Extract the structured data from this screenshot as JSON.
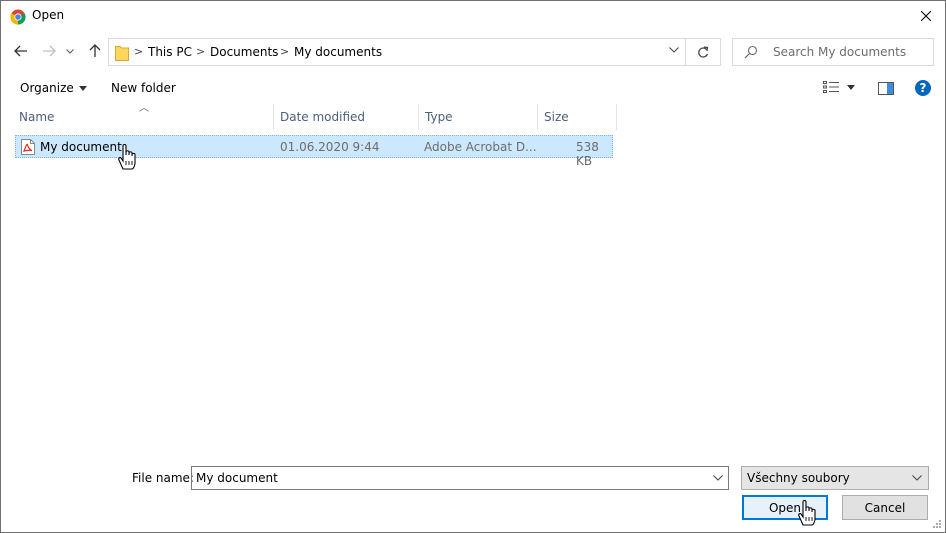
{
  "window": {
    "title": "Open",
    "icons": {
      "app": "chrome-icon",
      "close": "close-icon"
    }
  },
  "nav": {
    "back_icon": "arrow-left-icon",
    "forward_icon": "arrow-right-icon",
    "recent_icon": "chevron-down-icon",
    "up_icon": "arrow-up-icon",
    "breadcrumbs": [
      "This PC",
      "Documents",
      "My documents"
    ],
    "refresh_icon": "refresh-icon",
    "search_placeholder": "Search My documents"
  },
  "toolbar": {
    "organize_label": "Organize",
    "new_folder_label": "New folder",
    "view_icon": "details-view-icon",
    "preview_icon": "preview-pane-icon",
    "help_label": "?"
  },
  "columns": [
    {
      "label": "Name"
    },
    {
      "label": "Date modified"
    },
    {
      "label": "Type"
    },
    {
      "label": "Size"
    }
  ],
  "files": [
    {
      "name": "My document",
      "date": "01.06.2020 9:44",
      "type": "Adobe Acrobat D...",
      "size": "538 KB",
      "icon": "pdf-icon",
      "selected": true
    }
  ],
  "bottom": {
    "file_name_label": "File name:",
    "file_name_value": "My document",
    "file_type_value": "Všechny soubory",
    "open_label": "Open",
    "cancel_label": "Cancel"
  },
  "colors": {
    "selection": "#cce8ff",
    "accent": "#0078d7",
    "help": "#0067c0"
  }
}
